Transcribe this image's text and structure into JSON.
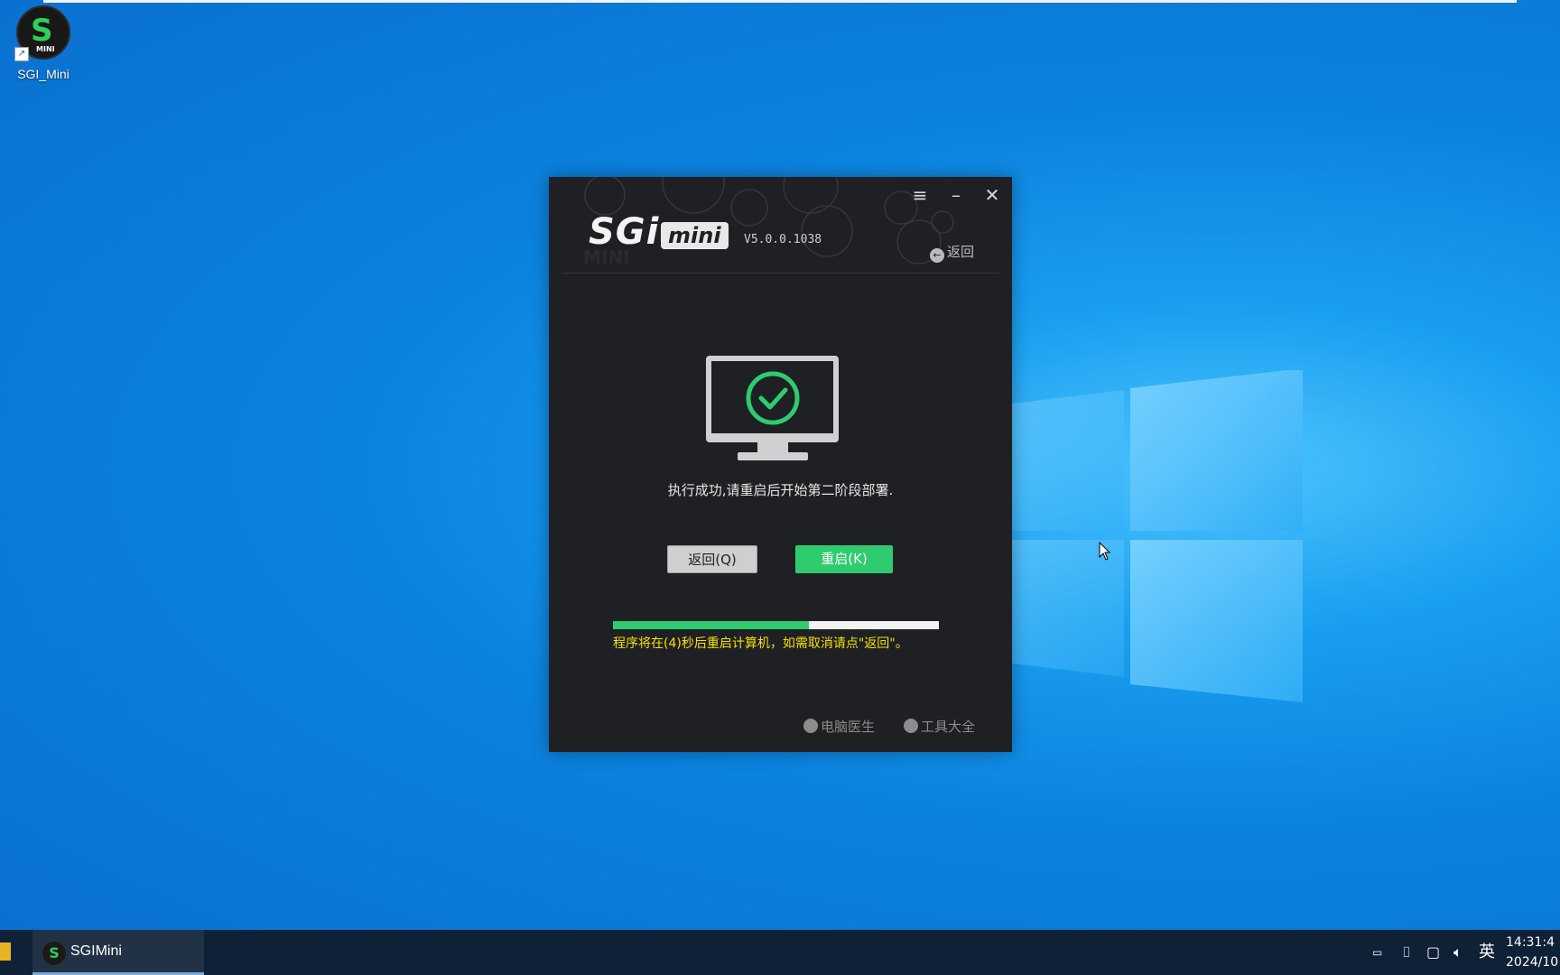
{
  "desktop": {
    "icon_label": "SGI_Mini"
  },
  "app": {
    "logo_text": "SGi",
    "logo_badge": "mini",
    "version": "V5.0.0.1038",
    "back_link": "返回",
    "message": "执行成功,请重启后开始第二阶段部署.",
    "back_button": "返回(Q)",
    "restart_button": "重启(K)",
    "progress_fraction": 0.6,
    "countdown": "程序将在(4)秒后重启计算机，如需取消请点\"返回\"。",
    "footer_links": [
      "电脑医生",
      "工具大全"
    ],
    "colors": {
      "accent": "#2ecc6f",
      "background": "#1f2024",
      "countdown": "#f2e200"
    }
  },
  "taskbar": {
    "app_label": "SGIMini",
    "ime": "英",
    "time": "14:31:4",
    "date": "2024/10"
  }
}
